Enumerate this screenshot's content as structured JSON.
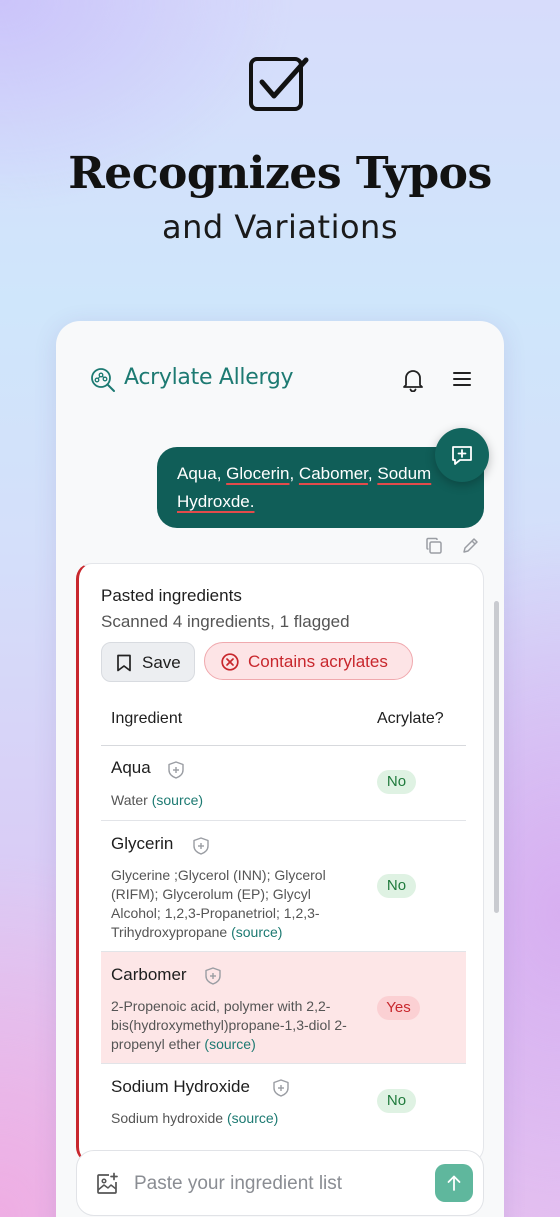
{
  "hero": {
    "icon": "checkbox-check-icon",
    "title": "Recognizes Typos",
    "subtitle": "and Variations"
  },
  "app": {
    "title": "Acrylate Allergy",
    "logo_icon": "molecule-search-icon",
    "bell_icon": "bell-icon",
    "menu_icon": "hamburger-menu-icon",
    "accent": "#1d7a72"
  },
  "message": {
    "parts": [
      "Aqua",
      ", ",
      "Glocerin",
      ", ",
      "Cabomer",
      ", ",
      "Sodum",
      " ",
      "Hydroxde."
    ],
    "typos": [
      "Glocerin",
      "Cabomer",
      "Sodum",
      "Hydroxde."
    ],
    "fab_icon": "new-chat-icon",
    "copy_icon": "copy-icon",
    "edit_icon": "pencil-icon"
  },
  "result": {
    "title": "Pasted ingredients",
    "summary": "Scanned 4 ingredients, 1 flagged",
    "save_label": "Save",
    "status_label": "Contains acrylates",
    "status_color": "#c8272d",
    "columns": [
      "Ingredient",
      "Acrylate?"
    ],
    "rows": [
      {
        "name": "Aqua",
        "description": "Water",
        "source_label": "(source)",
        "acrylate": "No",
        "flagged": false
      },
      {
        "name": "Glycerin",
        "description": "Glycerine ;Glycerol (INN); Glycerol (RIFM); Glycerolum (EP); Glycyl Alcohol; 1,2,3-Propanetriol; 1,2,3-Trihydroxypropane",
        "source_label": "(source)",
        "acrylate": "No",
        "flagged": false
      },
      {
        "name": "Carbomer",
        "description": "2-Propenoic acid, polymer with 2,2-bis(hydroxymethyl)propane-1,3-diol 2-propenyl ether",
        "source_label": "(source)",
        "acrylate": "Yes",
        "flagged": true
      },
      {
        "name": "Sodium Hydroxide",
        "description": "Sodium hydroxide",
        "source_label": "(source)",
        "acrylate": "No",
        "flagged": false
      }
    ]
  },
  "composer": {
    "placeholder": "Paste your ingredient list",
    "attach_icon": "add-image-icon",
    "send_icon": "arrow-up-icon"
  }
}
